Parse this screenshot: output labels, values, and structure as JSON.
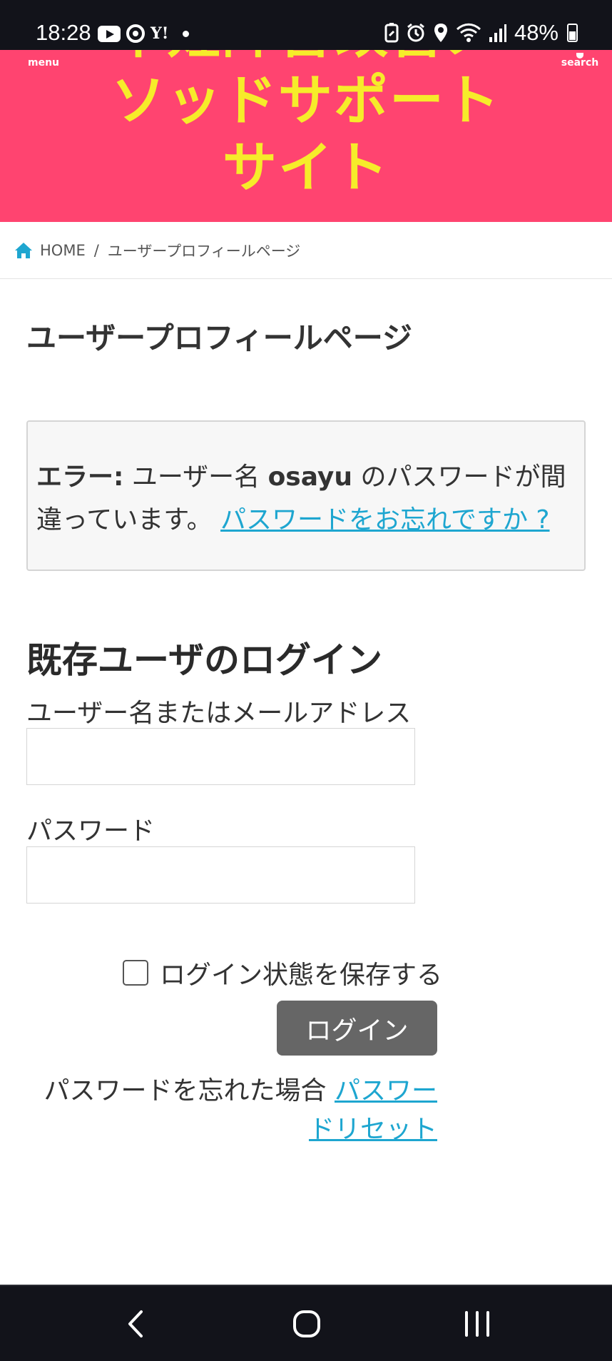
{
  "status_bar": {
    "time": "18:28",
    "yahoo": "Y!",
    "battery": "48%"
  },
  "header": {
    "menu_label": "menu",
    "search_label": "search",
    "site_title": "不妊障害改善メソッドサポートサイト"
  },
  "breadcrumb": {
    "home": "HOME",
    "separator": "/",
    "current": "ユーザープロフィールページ"
  },
  "page_title": "ユーザープロフィールページ",
  "error": {
    "label": "エラー:",
    "text_before": " ユーザー名 ",
    "username": "osayu",
    "text_after": " のパスワードが間違っています。 ",
    "link": "パスワードをお忘れですか ?"
  },
  "login": {
    "title": "既存ユーザのログイン",
    "username_label": "ユーザー名またはメールアドレス",
    "password_label": "パスワード",
    "remember_label": "ログイン状態を保存する",
    "submit_label": "ログイン",
    "forgot_text": "パスワードを忘れた場合 ",
    "forgot_link": "パスワードリセット"
  },
  "colors": {
    "header_bg": "#ff4470",
    "title_color": "#f6ec2a",
    "link_color": "#1ea6d0",
    "button_bg": "#666666"
  }
}
